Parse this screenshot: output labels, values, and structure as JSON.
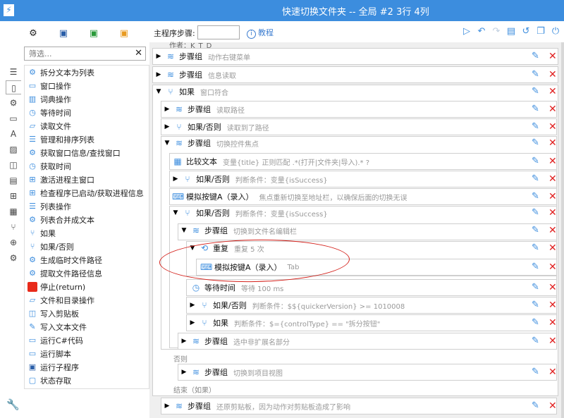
{
  "window": {
    "title": "快速切换文件夹 -- 全局 #2 3行 4列",
    "icon": "lightning-icon"
  },
  "side_tabs": [
    {
      "icon": "gears-icon",
      "color": "#222222"
    },
    {
      "icon": "cubes-blue-icon",
      "color": "#2a5ea8"
    },
    {
      "icon": "cubes-green-icon",
      "color": "#2a9a3a"
    },
    {
      "icon": "cubes-orange-icon",
      "color": "#e89a20"
    }
  ],
  "toolbar": {
    "main_step_label": "主程序步骤:",
    "main_step_value": "",
    "help_label": "教程",
    "icons": [
      "play-icon",
      "undo-icon",
      "redo-icon",
      "save-icon",
      "history-icon",
      "copy-icon",
      "power-icon"
    ]
  },
  "search": {
    "placeholder": "筛选...",
    "clear": "✕"
  },
  "rail": [
    "list-icon",
    "bookmark-icon",
    "gear-icon",
    "window-icon",
    "font-icon",
    "image-icon",
    "clipboard-icon",
    "document-icon",
    "windows-icon",
    "table-icon",
    "branch-icon",
    "globe-icon",
    "gears-icon"
  ],
  "palette": [
    "拆分文本为列表",
    "窗口操作",
    "词典操作",
    "等待时间",
    "读取文件",
    "管理和排序列表",
    "获取窗口信息/查找窗口",
    "获取时间",
    "激活进程主窗口",
    "检查程序已启动/获取进程信息",
    "列表操作",
    "列表合并成文本",
    "如果",
    "如果/否则",
    "生成临时文件路径",
    "提取文件路径信息",
    "停止(return)",
    "文件和目录操作",
    "写入剪贴板",
    "写入文本文件",
    "运行C#代码",
    "运行脚本",
    "运行子程序",
    "状态存取"
  ],
  "rows": [
    {
      "name": "步骤组",
      "desc": "动作右键菜单"
    },
    {
      "name": "步骤组",
      "desc": "信息读取"
    },
    {
      "name": "如果",
      "desc": "窗口符合"
    },
    {
      "name": "步骤组",
      "desc": "读取路径"
    },
    {
      "name": "如果/否则",
      "desc": "读取到了路径"
    },
    {
      "name": "步骤组",
      "desc": "切换控件焦点"
    },
    {
      "name": "比较文本",
      "desc": "变量{title} 正则匹配 .*(打开|文件夹|导入).* ?"
    },
    {
      "name": "如果/否则",
      "desc": "判断条件：变量{isSuccess}"
    },
    {
      "name": "模拟按键A（录入）",
      "desc": "焦点重新切换至地址栏，以确保后面的切换无误"
    },
    {
      "name": "如果/否则",
      "desc": "判断条件：变量{isSuccess}"
    },
    {
      "name": "步骤组",
      "desc": "切换到文件名编辑栏"
    },
    {
      "name": "重复",
      "desc": "重复 5 次"
    },
    {
      "name": "模拟按键A（录入）",
      "desc": "Tab"
    },
    {
      "name": "等待时间",
      "desc": "等待 100 ms"
    },
    {
      "name": "如果/否则",
      "desc": "判断条件：$${quickerVersion} >= 1010008"
    },
    {
      "name": "如果",
      "desc": "判断条件：$={controlType} == \"拆分按钮\""
    },
    {
      "name": "步骤组",
      "desc": "选中非扩展名部分"
    },
    {
      "name": "步骤组",
      "desc": "切换到项目视图"
    },
    {
      "name": "步骤组",
      "desc": "还原剪贴板，因为动作对剪贴板造成了影响"
    }
  ],
  "labels": {
    "top_partial": "作者：K_T_D",
    "else": "否则",
    "end_if": "结束（如果）"
  }
}
